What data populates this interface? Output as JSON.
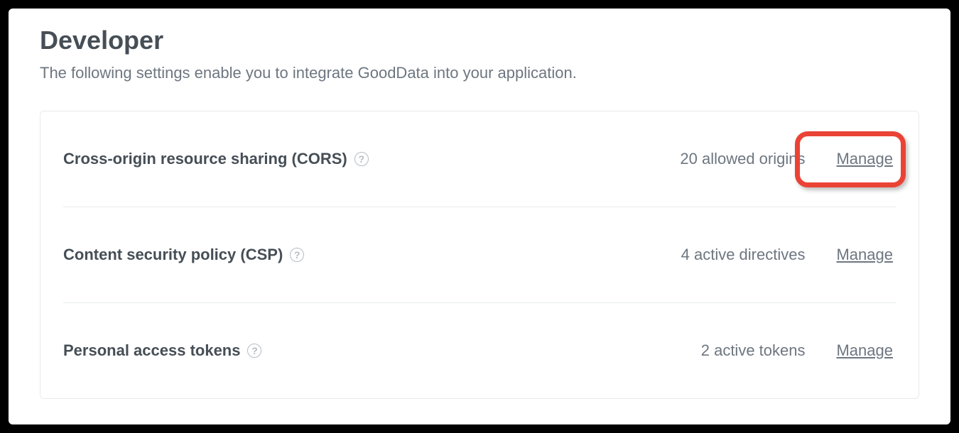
{
  "header": {
    "title": "Developer",
    "description": "The following settings enable you to integrate GoodData into your application."
  },
  "settings": {
    "cors": {
      "title": "Cross-origin resource sharing (CORS)",
      "status": "20 allowed origins",
      "action": "Manage"
    },
    "csp": {
      "title": "Content security policy (CSP)",
      "status": "4 active directives",
      "action": "Manage"
    },
    "tokens": {
      "title": "Personal access tokens",
      "status": "2 active tokens",
      "action": "Manage"
    }
  },
  "help_glyph": "?"
}
